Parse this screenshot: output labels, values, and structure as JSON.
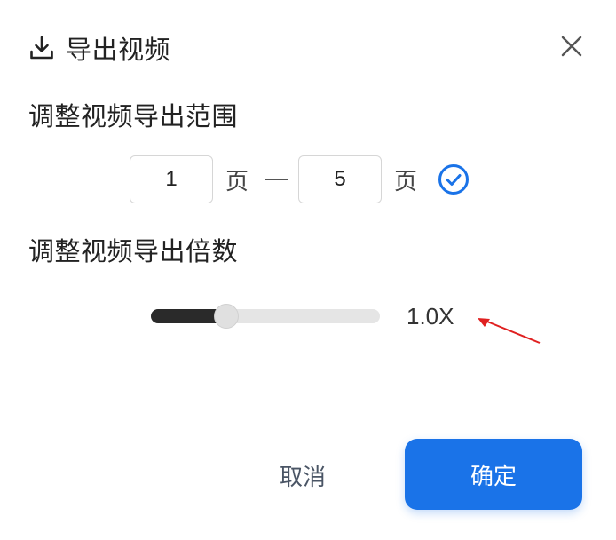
{
  "dialog": {
    "title": "导出视频",
    "title_icon": "download-icon",
    "close_icon": "close-icon"
  },
  "range": {
    "label": "调整视频导出范围",
    "start_value": "1",
    "end_value": "5",
    "unit": "页",
    "confirm_icon": "check-circle-icon"
  },
  "multiple": {
    "label": "调整视频导出倍数",
    "value_text": "1.0X",
    "slider_fraction": 0.33
  },
  "buttons": {
    "cancel_label": "取消",
    "ok_label": "确定"
  },
  "colors": {
    "primary": "#1a73e8",
    "annotation_arrow": "#e02020"
  }
}
